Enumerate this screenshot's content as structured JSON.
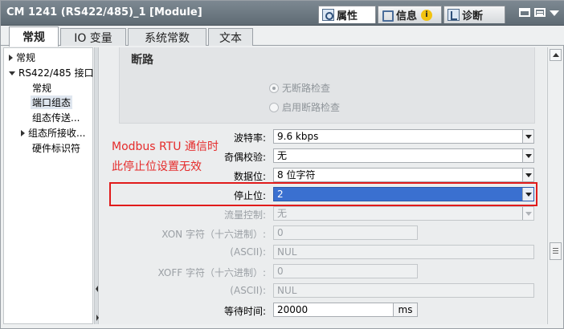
{
  "window": {
    "title": "CM 1241 (RS422/485)_1 [Module]"
  },
  "inspector_tabs": [
    {
      "label": "属性",
      "icon": "properties-icon"
    },
    {
      "label": "信息",
      "icon": "info-icon",
      "badge": "i"
    },
    {
      "label": "诊断",
      "icon": "diagnostics-icon"
    }
  ],
  "main_tabs": [
    "常规",
    "IO 变量",
    "系统常数",
    "文本"
  ],
  "tree": {
    "items": [
      {
        "label": "常规",
        "level": 0,
        "expander": "collapsed"
      },
      {
        "label": "RS422/485 接口",
        "level": 0,
        "expander": "expanded"
      },
      {
        "label": "常规",
        "level": 1
      },
      {
        "label": "端口组态",
        "level": 1,
        "selected": true
      },
      {
        "label": "组态传送...",
        "level": 1
      },
      {
        "label": "组态所接收...",
        "level": 1,
        "expander": "collapsed"
      },
      {
        "label": "硬件标识符",
        "level": 1
      }
    ]
  },
  "break_section": {
    "title": "断路",
    "options": [
      {
        "label": "无断路检查",
        "selected": true
      },
      {
        "label": "启用断路检查",
        "selected": false
      }
    ]
  },
  "fields": {
    "baud_rate": {
      "label": "波特率:",
      "value": "9.6 kbps"
    },
    "parity": {
      "label": "奇偶校验:",
      "value": "无"
    },
    "data_bits": {
      "label": "数据位:",
      "value": "8 位字符"
    },
    "stop_bits": {
      "label": "停止位:",
      "value": "2"
    },
    "flow_control": {
      "label": "流量控制:",
      "value": "无"
    },
    "xon_hex": {
      "label": "XON 字符（十六进制）:",
      "value": "0"
    },
    "xon_ascii": {
      "label": "(ASCII):",
      "value": "NUL"
    },
    "xoff_hex": {
      "label": "XOFF 字符（十六进制）:",
      "value": "0"
    },
    "xoff_ascii": {
      "label": "(ASCII):",
      "value": "NUL"
    },
    "wait_time": {
      "label": "等待时间:",
      "value": "20000",
      "unit": "ms"
    }
  },
  "annotation": {
    "line1": "Modbus RTU 通信时",
    "line2": "此停止位设置无效",
    "color": "#e52b2b"
  },
  "colors": {
    "highlight": "#3a70d0",
    "annotation_box": "#e11b1b",
    "titlebar": "#6b7680"
  }
}
